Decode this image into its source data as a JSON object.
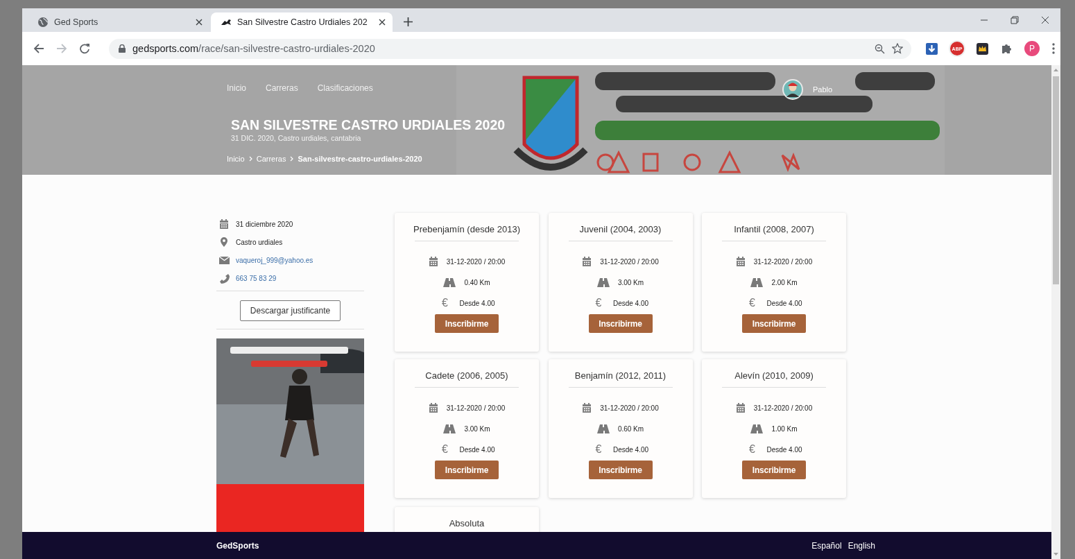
{
  "browser": {
    "tabs": [
      {
        "title": "Ged Sports",
        "kind": "globe",
        "selected": false
      },
      {
        "title": "San Silvestre Castro Urdiales 202",
        "kind": "runner",
        "selected": true
      }
    ],
    "forward_disabled": true,
    "address": {
      "host": "gedsports.com",
      "path": "/race/san-silvestre-castro-urdiales-2020"
    },
    "extensions": [
      {
        "kind": "download"
      },
      {
        "kind": "adblock",
        "label": "ABP"
      },
      {
        "kind": "crown"
      },
      {
        "kind": "puzzle"
      }
    ],
    "profile_initial": "P"
  },
  "header": {
    "nav": [
      "Inicio",
      "Carreras",
      "Clasificaciones"
    ],
    "user": "Pablo",
    "banner": {
      "kind": "picture"
    },
    "title": "SAN SILVESTRE CASTRO URDIALES 2020",
    "subtitle": "31 DIC. 2020, Castro urdiales, cantabria",
    "breadcrumbs": [
      {
        "label": "Inicio",
        "current": false
      },
      {
        "label": "Carreras",
        "current": false
      },
      {
        "label": "San-silvestre-castro-urdiales-2020",
        "current": true
      }
    ]
  },
  "sidebar": {
    "info": [
      {
        "kind": "date",
        "text": "31 diciembre 2020"
      },
      {
        "kind": "place",
        "text": "Castro urdiales"
      },
      {
        "kind": "email",
        "text": "vaqueroj_999@yahoo.es"
      },
      {
        "kind": "phone",
        "text": "663 75 83 29"
      }
    ],
    "button": "Descargar justificante",
    "poster": {
      "kind": "picture"
    }
  },
  "categories": [
    {
      "title": "Prebenjamín (desde 2013)",
      "datetime": "31-12-2020 / 20:00",
      "distance": "0.40 Km",
      "currency": "€",
      "price": "Desde 4.00",
      "button": "Inscribirme"
    },
    {
      "title": "Juvenil (2004, 2003)",
      "datetime": "31-12-2020 / 20:00",
      "distance": "3.00 Km",
      "currency": "€",
      "price": "Desde 4.00",
      "button": "Inscribirme"
    },
    {
      "title": "Infantil (2008, 2007)",
      "datetime": "31-12-2020 / 20:00",
      "distance": "2.00 Km",
      "currency": "€",
      "price": "Desde 4.00",
      "button": "Inscribirme"
    },
    {
      "title": "Cadete (2006, 2005)",
      "datetime": "31-12-2020 / 20:00",
      "distance": "3.00 Km",
      "currency": "€",
      "price": "Desde 4.00",
      "button": "Inscribirme"
    },
    {
      "title": "Benjamín (2012, 2011)",
      "datetime": "31-12-2020 / 20:00",
      "distance": "0.60 Km",
      "currency": "€",
      "price": "Desde 4.00",
      "button": "Inscribirme"
    },
    {
      "title": "Alevín (2010, 2009)",
      "datetime": "31-12-2020 / 20:00",
      "distance": "1.00 Km",
      "currency": "€",
      "price": "Desde 4.00",
      "button": "Inscribirme"
    },
    {
      "title": "Absoluta"
    }
  ],
  "footer": {
    "brand": "GedSports",
    "languages": [
      "Español",
      "English"
    ]
  }
}
